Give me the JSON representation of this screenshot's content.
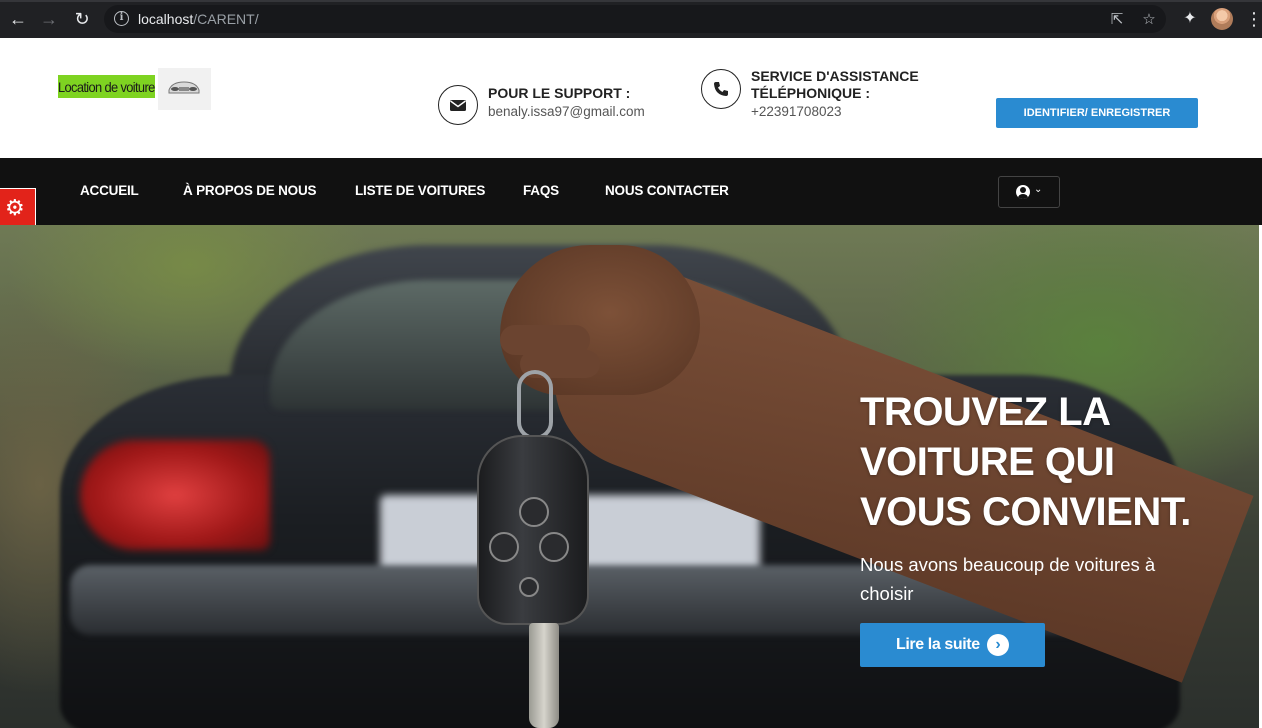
{
  "browser": {
    "url_host": "localhost",
    "url_path": "/CARENT/",
    "icons": [
      "back-icon",
      "forward-icon",
      "reload-icon",
      "info-icon",
      "share-icon",
      "star-icon",
      "extensions-icon",
      "profile-avatar",
      "more-icon"
    ]
  },
  "header": {
    "logo_text": "Location de voiture",
    "support": {
      "title": "POUR LE SUPPORT :",
      "value": "benaly.issa97@gmail.com",
      "icon": "envelope-icon"
    },
    "phone": {
      "title_line1": "SERVICE D'ASSISTANCE",
      "title_line2": "TÉLÉPHONIQUE :",
      "value": "+22391708023",
      "icon": "phone-icon"
    },
    "login_button": "IDENTIFIER/ ENREGISTRER"
  },
  "nav": {
    "items": [
      "ACCUEIL",
      "À PROPOS DE NOUS",
      "LISTE DE VOITURES",
      "FAQS",
      "NOUS CONTACTER"
    ],
    "user_menu_icon": "user-circle-icon"
  },
  "hero": {
    "title_lines": [
      "TROUVEZ LA",
      "VOITURE QUI",
      "VOUS CONVIENT."
    ],
    "subtitle": "Nous avons beaucoup de voitures à choisir",
    "cta_label": "Lire la suite"
  },
  "colors": {
    "accent_blue": "#2a8bd1",
    "navbar_bg": "#111111",
    "logo_green": "#7ed321",
    "settings_tab_red": "#e2231a"
  }
}
